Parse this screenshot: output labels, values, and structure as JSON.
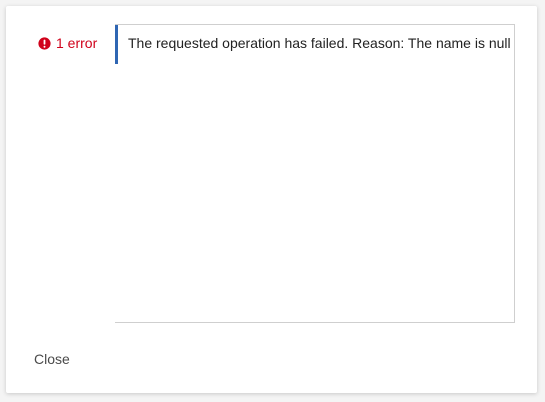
{
  "dialog": {
    "error_badge": {
      "icon": "exclamation-circle-icon",
      "label": "1 error",
      "color": "#d0021b"
    },
    "messages": [
      {
        "text": "The requested operation has failed. Reason: The name is null",
        "accent_color": "#2f66b3"
      }
    ],
    "close_label": "Close"
  }
}
